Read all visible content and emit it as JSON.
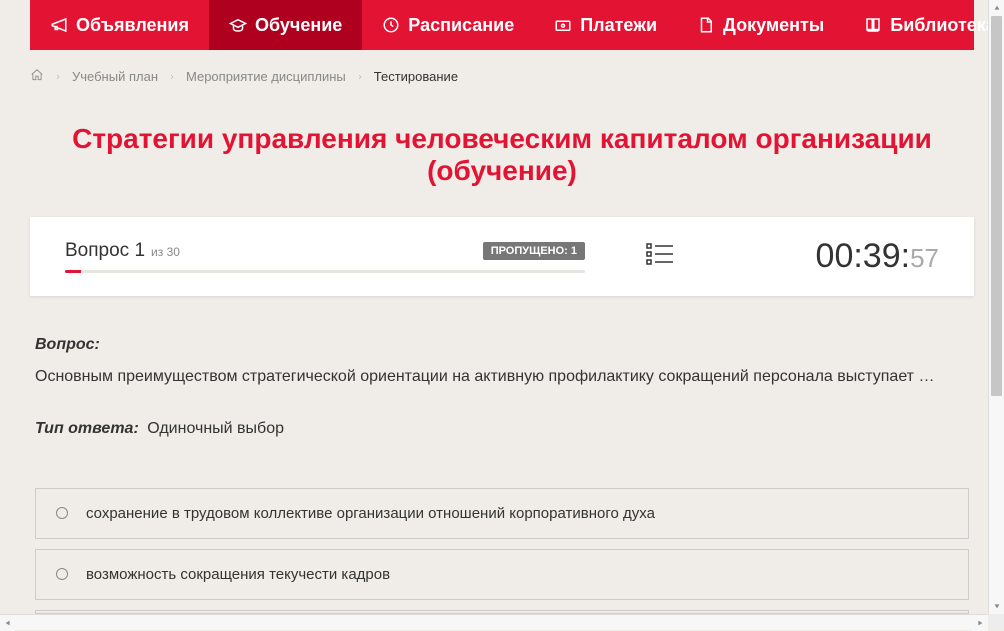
{
  "nav": {
    "items": [
      {
        "label": "Объявления",
        "icon": "megaphone"
      },
      {
        "label": "Обучение",
        "icon": "graduation",
        "active": true
      },
      {
        "label": "Расписание",
        "icon": "clock"
      },
      {
        "label": "Платежи",
        "icon": "payment"
      },
      {
        "label": "Документы",
        "icon": "document"
      },
      {
        "label": "Библиотека",
        "icon": "book",
        "dropdown": true
      }
    ]
  },
  "breadcrumb": {
    "items": [
      {
        "label": "Учебный план",
        "link": true
      },
      {
        "label": "Мероприятие дисциплины",
        "link": true
      },
      {
        "label": "Тестирование",
        "link": false
      }
    ]
  },
  "page_title": "Стратегии управления человеческим капиталом организации (обучение)",
  "progress": {
    "question_label": "Вопрос",
    "question_num": "1",
    "question_of": "из",
    "question_total": "30",
    "skipped_label": "ПРОПУЩЕНО: 1",
    "timer_main": "00:39:",
    "timer_sec": "57"
  },
  "question": {
    "header": "Вопрос:",
    "text": "Основным преимуществом стратегической ориентации на активную профилактику сокращений персонала выступает …"
  },
  "answer_type": {
    "label": "Тип ответа:",
    "value": "Одиночный выбор"
  },
  "options": [
    {
      "text": "сохранение в трудовом коллективе организации отношений корпоративного духа"
    },
    {
      "text": "возможность сокращения текучести кадров"
    }
  ]
}
